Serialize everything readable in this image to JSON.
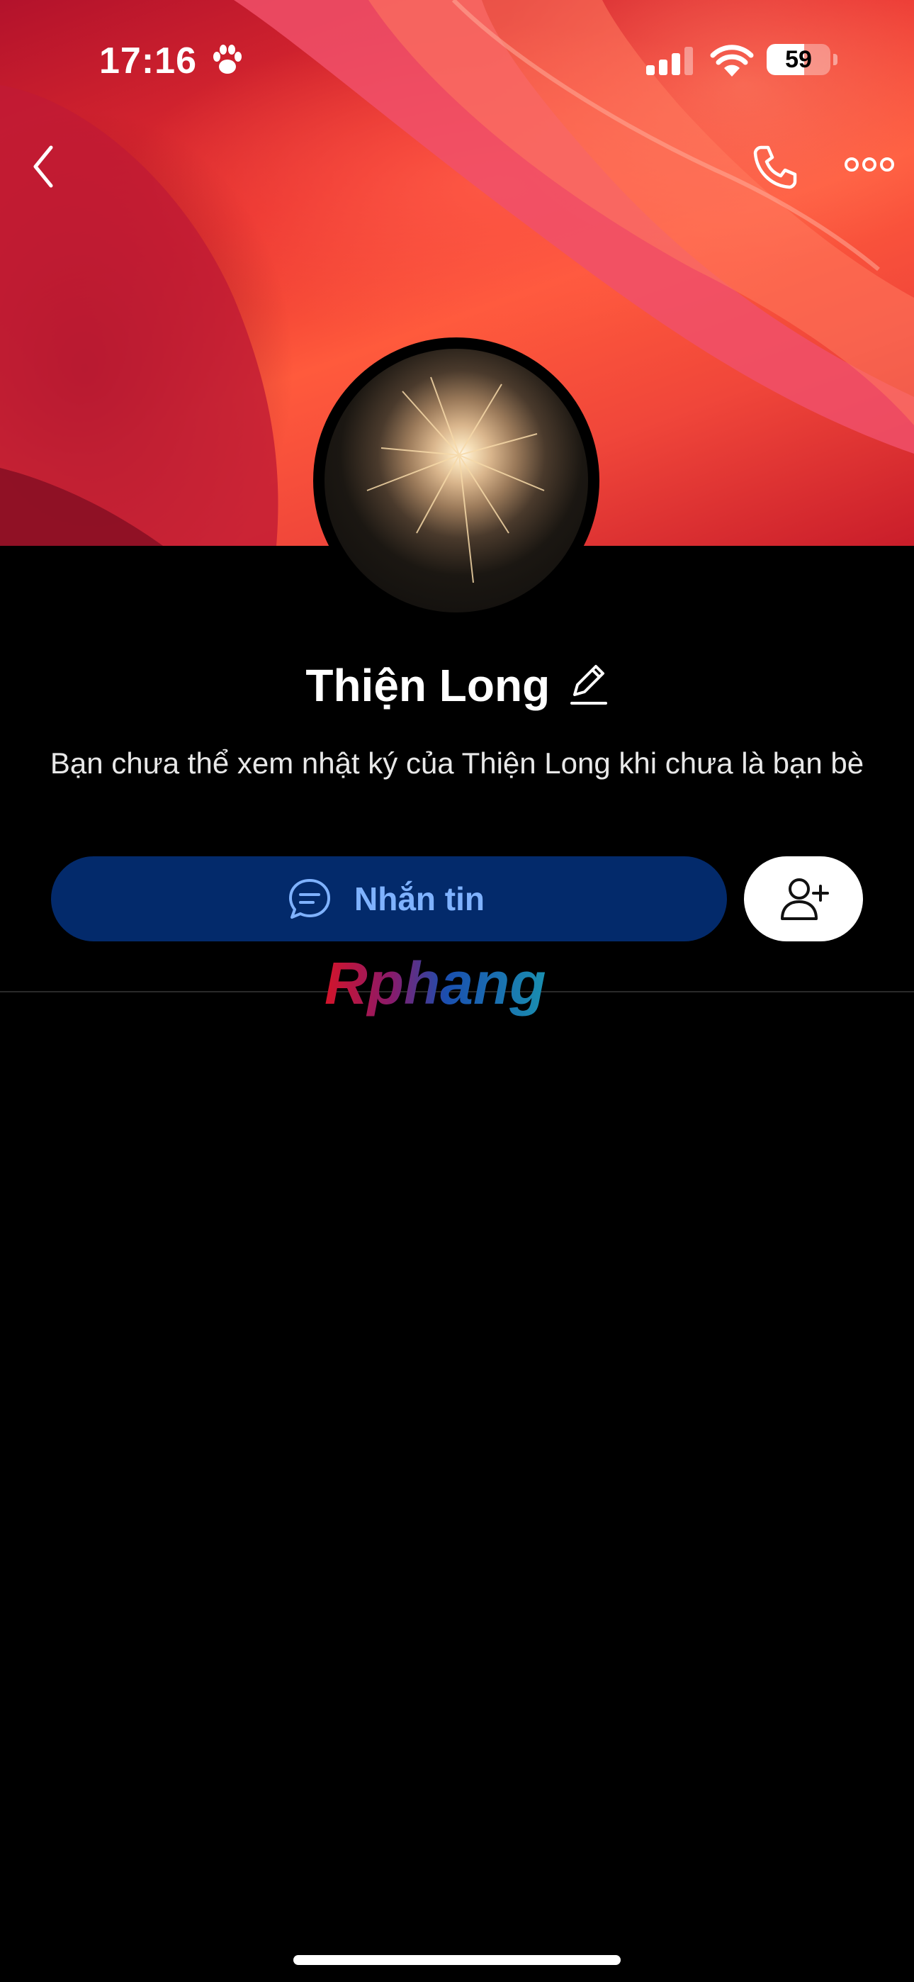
{
  "status_bar": {
    "time": "17:16",
    "battery_level": 59,
    "battery_label": "59",
    "icons": [
      "paw-icon",
      "cellular-signal-icon",
      "wifi-icon",
      "battery-icon"
    ]
  },
  "nav": {
    "icons": [
      "back-chevron-icon",
      "phone-icon",
      "more-options-icon"
    ]
  },
  "profile": {
    "name": "Thiện Long",
    "notice": "Bạn chưa thể xem nhật ký của Thiện Long khi chưa là bạn bè"
  },
  "actions": {
    "message_label": "Nhắn tin",
    "message_icon": "chat-bubble-icon",
    "add_friend_icon": "add-friend-icon"
  },
  "watermark": {
    "text": "Rphang"
  },
  "colors": {
    "message_button_bg": "#032a6b",
    "message_button_text": "#7fb2ff",
    "background": "#000000"
  }
}
